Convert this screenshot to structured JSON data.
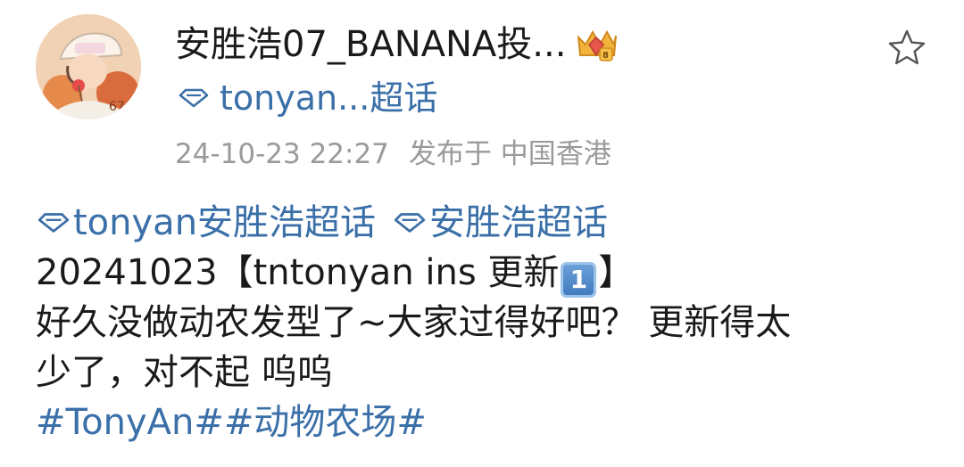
{
  "author": {
    "name": "安胜浩07_BANANA投...",
    "avatar_icon": "avatar-illustration"
  },
  "topic": {
    "label": "tonyan...超话",
    "icon": "diamond-icon"
  },
  "meta": {
    "timestamp": "24-10-23 22:27",
    "location": "发布于 中国香港"
  },
  "post": {
    "tags": [
      {
        "label": "tonyan安胜浩超话",
        "icon": "diamond-icon"
      },
      {
        "label": "安胜浩超话",
        "icon": "diamond-icon"
      }
    ],
    "line1_prefix": "20241023【tntonyan ins 更新",
    "keycap": "1",
    "line1_suffix": "】",
    "line2": "好久没做动农发型了~大家过得好吧？ 更新得太",
    "line3": "少了，对不起 呜呜",
    "hashtags": [
      "#TonyAn#",
      "#动物农场#"
    ]
  },
  "colors": {
    "link": "#3a6fa8",
    "meta": "#9a9a9a",
    "text": "#1a1a1a"
  }
}
